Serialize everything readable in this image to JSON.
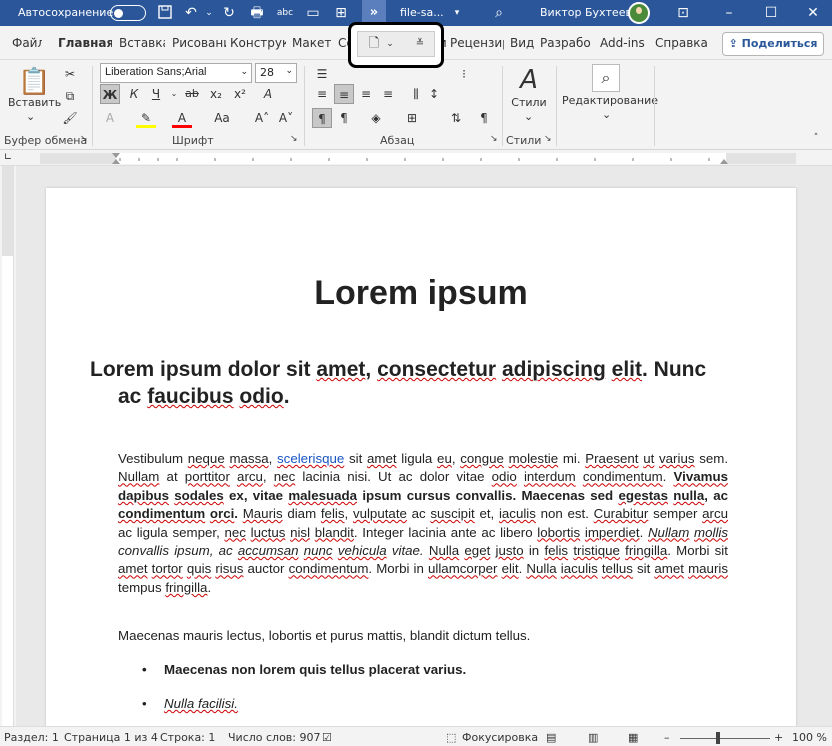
{
  "titlebar": {
    "autosave_label": "Автосохранение",
    "filename": "file-sa...",
    "user": "Виктор Бухтеев",
    "more": "»"
  },
  "tabs": [
    {
      "label": "Файл"
    },
    {
      "label": "Главная"
    },
    {
      "label": "Вставка"
    },
    {
      "label": "Рисовани"
    },
    {
      "label": "Конструк"
    },
    {
      "label": "Макет"
    },
    {
      "label": "Сс"
    },
    {
      "label": "лки"
    },
    {
      "label": "Рецензир"
    },
    {
      "label": "Вид"
    },
    {
      "label": "Разрабо"
    },
    {
      "label": "Add-ins"
    },
    {
      "label": "Справка"
    }
  ],
  "share_label": "Поделиться",
  "ribbon": {
    "paste_label": "Вставить",
    "font_name": "Liberation Sans;Arial",
    "font_size": "28",
    "groups": {
      "clipboard": "Буфер обмена",
      "font": "Шрифт",
      "paragraph": "Абзац",
      "styles": "Стили"
    },
    "styles_label": "Стили",
    "editing_label": "Редактирование",
    "bold": "Ж",
    "italic": "К",
    "underline": "Ч",
    "strike": "ab",
    "sub": "x₂",
    "sup": "x²"
  },
  "document": {
    "title": "Lorem ipsum",
    "subtitle": "Lorem ipsum dolor sit amet, consectetur adipiscing elit. Nunc ac faucibus odio.",
    "para2": "Maecenas mauris lectus, lobortis et purus mattis, blandit dictum tellus.",
    "bullets": [
      "Maecenas non lorem quis tellus placerat varius.",
      "Nulla facilisi."
    ]
  },
  "status": {
    "page_section": "Раздел: 1",
    "page": "Страница 1 из 4",
    "line": "Строка: 1",
    "words": "Число слов: 907",
    "focus": "Фокусировка",
    "zoom": "100 %"
  },
  "colors": {
    "titlebar": "#2b579a",
    "highlight": "#ffff00",
    "font_color": "#ff0000"
  }
}
